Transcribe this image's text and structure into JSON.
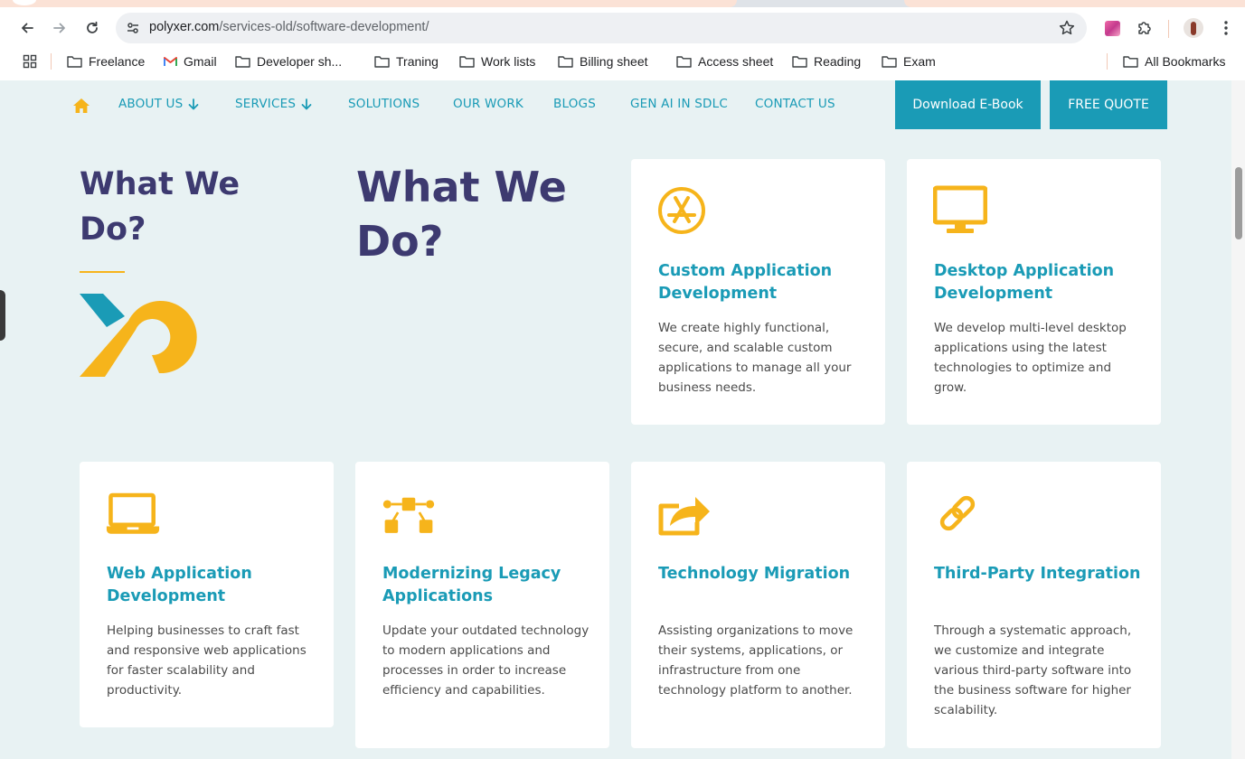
{
  "browser": {
    "url_host": "polyxer.com",
    "url_path": "/services-old/software-development/",
    "bookmarks": [
      "Freelance",
      "Gmail",
      "Developer sh...",
      "Traning",
      "Work lists",
      "Billing sheet",
      "Access sheet",
      "Reading",
      "Exam"
    ],
    "all_bookmarks_label": "All Bookmarks"
  },
  "nav": {
    "items": [
      "ABOUT US",
      "SERVICES",
      "SOLUTIONS",
      "OUR WORK",
      "BLOGS",
      "GEN AI IN SDLC",
      "CONTACT US"
    ],
    "download_label": "Download E-Book",
    "quote_label": "FREE QUOTE"
  },
  "section": {
    "side_title": "What We Do?",
    "main_title": "What We Do?"
  },
  "cards": [
    {
      "icon": "app-store-icon",
      "title": "Custom Application Development",
      "text": "We create highly functional, secure, and scalable custom applications to manage all your business needs."
    },
    {
      "icon": "desktop-monitor-icon",
      "title": "Desktop Application Development",
      "text": "We develop multi-level desktop applications using the latest technologies to optimize and grow."
    },
    {
      "icon": "laptop-icon",
      "title": "Web Application Development",
      "text": "Helping businesses to craft fast and responsive web applications for faster scalability and productivity."
    },
    {
      "icon": "vector-nodes-icon",
      "title": "Modernizing Legacy Applications",
      "text": "Update your outdated technology to modern applications and processes in order to increase efficiency and capabilities."
    },
    {
      "icon": "share-arrow-icon",
      "title": "Technology Migration",
      "text": "Assisting organizations to move their systems, applications, or infrastructure from one technology platform to another."
    },
    {
      "icon": "link-icon",
      "title": "Third-Party Integration",
      "text": "Through a systematic approach, we customize and integrate various third-party software into the business software for higher scalability."
    }
  ],
  "colors": {
    "accent": "#1a9bb6",
    "heading": "#3d3a70",
    "icon": "#f6b41b",
    "page_bg": "#e8f2f3"
  }
}
